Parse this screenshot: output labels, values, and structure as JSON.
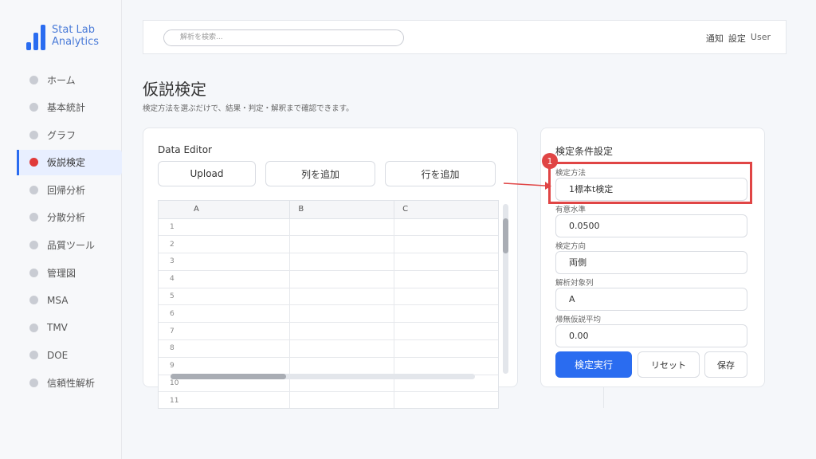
{
  "app": {
    "name": "Stat Lab Analytics",
    "brand_color": "#2a6cf0",
    "alert_color": "#e04545"
  },
  "sidebar": {
    "items": [
      {
        "label": "ホーム",
        "active": false
      },
      {
        "label": "基本統計",
        "active": false
      },
      {
        "label": "グラフ",
        "active": false
      },
      {
        "label": "仮説検定",
        "active": true
      },
      {
        "label": "回帰分析",
        "active": false
      },
      {
        "label": "分散分析",
        "active": false
      },
      {
        "label": "品質ツール",
        "active": false
      },
      {
        "label": "管理図",
        "active": false
      },
      {
        "label": "MSA",
        "active": false
      },
      {
        "label": "TMV",
        "active": false
      },
      {
        "label": "DOE",
        "active": false
      },
      {
        "label": "信頼性解析",
        "active": false
      }
    ]
  },
  "header": {
    "search_placeholder": "解析を検索...",
    "notifications": "通知",
    "settings": "設定",
    "user": "User"
  },
  "page": {
    "title": "仮説検定",
    "subtitle": "検定方法を選ぶだけで、結果・判定・解釈まで確認できます。"
  },
  "editor": {
    "title": "Data Editor",
    "upload_label": "Upload",
    "add_column_label": "列を追加",
    "add_row_label": "行を追加",
    "columns": [
      "A",
      "B",
      "C"
    ],
    "rows": [
      "1",
      "2",
      "3",
      "4",
      "5",
      "6",
      "7",
      "8",
      "9",
      "10",
      "11"
    ]
  },
  "settings": {
    "title": "検定条件設定",
    "method_label": "検定方法",
    "method_value": "1標本t検定",
    "alpha_label": "有意水準",
    "alpha_value": "0.0500",
    "direction_label": "検定方向",
    "direction_value": "両側",
    "target_label": "解析対象列",
    "target_value": "A",
    "null_mean_label": "帰無仮説平均",
    "null_mean_value": "0.00",
    "run_label": "検定実行",
    "reset_label": "リセット",
    "save_label": "保存"
  },
  "annotation": {
    "badge": "1"
  }
}
